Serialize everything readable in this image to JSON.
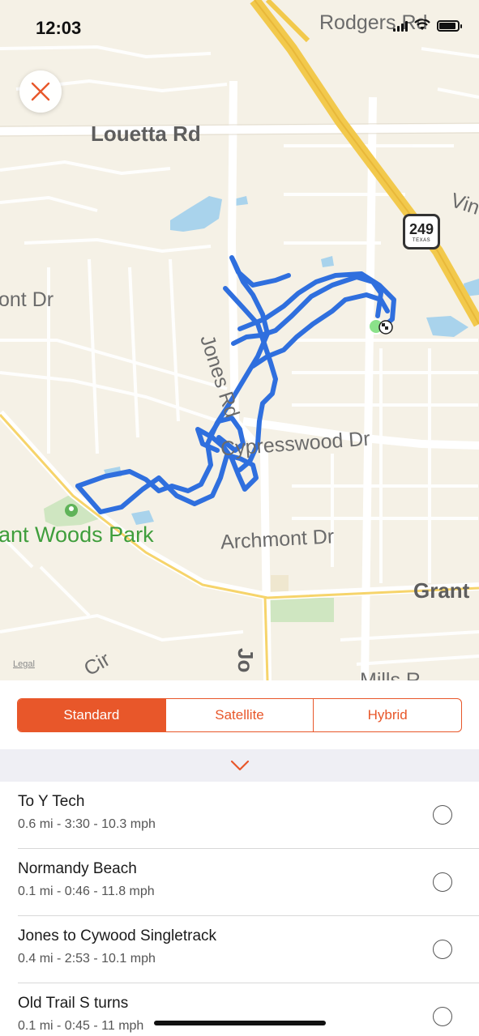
{
  "status_bar": {
    "time": "12:03"
  },
  "map": {
    "labels": {
      "rodgers_rd": "Rodgers Rd",
      "louetta_rd": "Louetta Rd",
      "vin": "Vin",
      "mont_dr": "ont Dr",
      "jones_rd": "Jones Rd",
      "cypresswood_dr": "Cypresswood Dr",
      "archmont_dr": "Archmont Dr",
      "grant": "Grant",
      "park": "ant Woods Park",
      "cir": "Cir",
      "mills": "Mills R",
      "jones_rd_lower": "Jo",
      "legal": "Legal"
    },
    "shield": {
      "number": "249",
      "state": "TEXAS"
    },
    "route_color": "#2f6fde",
    "start_marker_color": "#8be28a"
  },
  "map_type": {
    "options": [
      "Standard",
      "Satellite",
      "Hybrid"
    ],
    "selected": "Standard"
  },
  "accent_color": "#e8572a",
  "segments": [
    {
      "name": "To Y Tech",
      "stats": "0.6 mi - 3:30 - 10.3 mph"
    },
    {
      "name": "Normandy Beach",
      "stats": "0.1 mi - 0:46 - 11.8 mph"
    },
    {
      "name": "Jones to Cywood Singletrack",
      "stats": "0.4 mi - 2:53 - 10.1 mph"
    },
    {
      "name": "Old Trail S turns",
      "stats": "0.1 mi - 0:45 - 11 mph"
    }
  ]
}
